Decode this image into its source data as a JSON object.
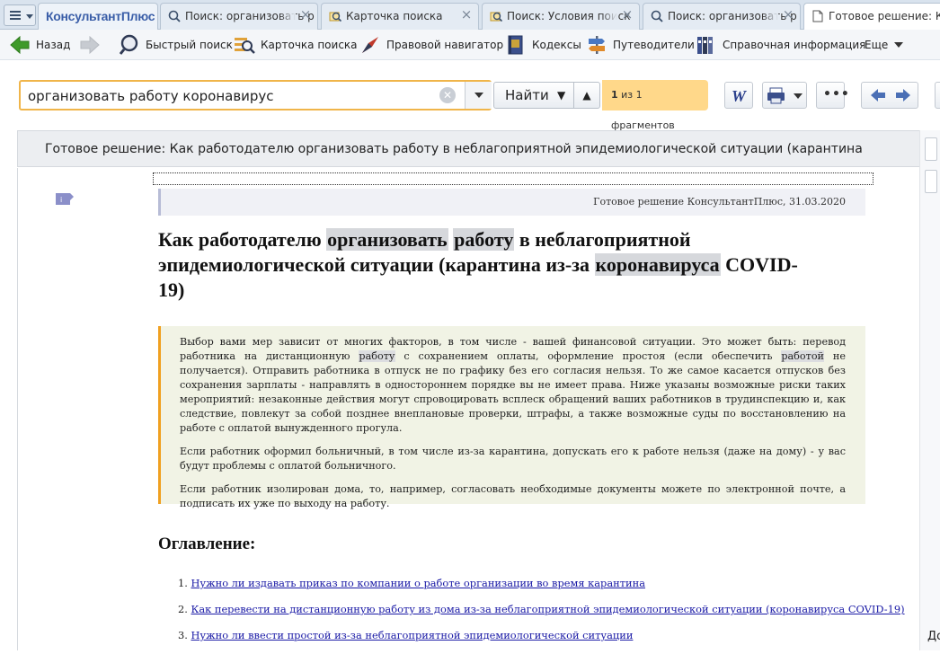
{
  "tabs": {
    "logo": "КонсультантПлюс",
    "items": [
      {
        "label": "Поиск: организовать р"
      },
      {
        "label": "Карточка поиска"
      },
      {
        "label": "Поиск: Условия поиск"
      },
      {
        "label": "Поиск: организовать р"
      },
      {
        "label": "Готовое решение: Как"
      }
    ]
  },
  "toolbar": {
    "back": "Назад",
    "quick_search": "Быстрый поиск",
    "search_card": "Карточка поиска",
    "legal_navigator": "Правовой навигатор",
    "codes": "Кодексы",
    "guides": "Путеводители",
    "reference": "Справочная информация",
    "more": "Еще"
  },
  "search": {
    "value": "организовать работу коронавирус",
    "find_label": "Найти",
    "fragment_count": "1",
    "fragment_text": "из 1 фрагментов"
  },
  "document": {
    "header": "Готовое решение: Как работодателю организовать работу в неблагоприятной эпидемиологической ситуации (карантина из-за...",
    "meta": "Готовое решение КонсультантПлюс, 31.03.2020",
    "title": {
      "t1": "Как работодателю ",
      "h1": "организовать",
      "t2": " ",
      "h2": "работу",
      "t3": " в неблагоприятной эпидемиологической ситуации (карантина из-за ",
      "h3": "коронавируса",
      "t4": " COVID-19)"
    },
    "lead": {
      "p1_a": "Выбор вами мер зависит от многих факторов, в том числе - вашей финансовой ситуации. Это может быть: перевод работника на дистанционную ",
      "p1_h1": "работу",
      "p1_b": " с сохранением оплаты, оформление простоя (если обеспечить ",
      "p1_h2": "работой",
      "p1_c": " не получается). Отправить работника в отпуск не по графику без его согласия нельзя. То же самое касается отпусков без сохранения зарплаты - направлять в одностороннем порядке вы не имеет права. Ниже указаны возможные риски таких мероприятий: незаконные действия могут спровоцировать всплеск обращений ваших работников в трудинспекцию и, как следствие, повлекут за собой позднее внеплановые проверки, штрафы, а также возможные суды по восстановлению на работе с оплатой вынужденного прогула.",
      "p2": "Если работник оформил больничный, в том числе из-за карантина, допускать его к работе нельзя (даже на дому) - у вас будут проблемы с оплатой больничного.",
      "p3": "Если работник изолирован дома, то, например, согласовать необходимые документы можете по электронной почте, а подписать их уже по выходу на работу."
    },
    "toc_title": "Оглавление:",
    "toc": [
      {
        "num": "1.",
        "text": "Нужно ли издавать приказ по компании о работе организации во время карантина"
      },
      {
        "num": "2.",
        "text": "Как перевести на дистанционную работу из дома из-за неблагоприятной эпидемиологической ситуации (коронавируса COVID-19)"
      },
      {
        "num": "3.",
        "text": "Нужно ли ввести простой из-за неблагоприятной эпидемиологической ситуации"
      }
    ]
  },
  "right_edge": {
    "label": "До"
  },
  "colors": {
    "accent": "#f0b54a",
    "tab_bg": "#d9e3ee",
    "lead_border": "#f0a020",
    "link": "#1a1aa6"
  }
}
